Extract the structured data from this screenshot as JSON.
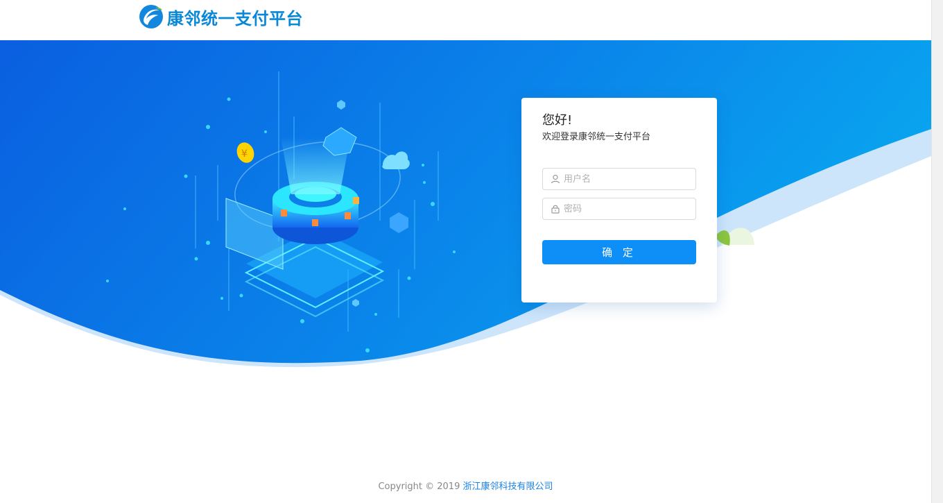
{
  "header": {
    "logo_text": "康邻统一支付平台"
  },
  "login": {
    "greeting": "您好!",
    "welcome": "欢迎登录康邻统一支付平台",
    "username_placeholder": "用户名",
    "password_placeholder": "密码",
    "submit_label": "确 定"
  },
  "footer": {
    "copyright": "Copyright © 2019 ",
    "company": "浙江康邻科技有限公司"
  },
  "colors": {
    "brand": "#0a88d8",
    "primary_button": "#0d8ff7",
    "banner_dark": "#0a62e0",
    "banner_light": "#0aa6ee"
  },
  "icons": [
    "logo-icon",
    "user-icon",
    "lock-icon",
    "leaf-icon"
  ]
}
